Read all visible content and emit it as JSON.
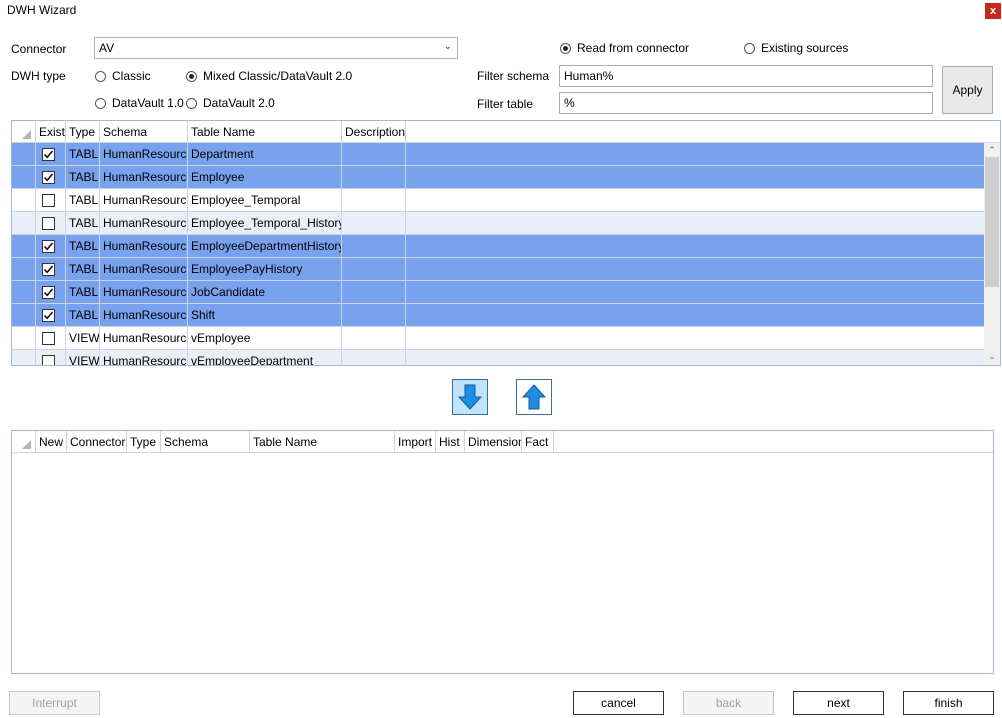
{
  "window": {
    "title": "DWH Wizard",
    "close_glyph": "x"
  },
  "connector": {
    "label": "Connector",
    "value": "AV"
  },
  "dwh_type": {
    "label": "DWH type",
    "options": [
      "Classic",
      "Mixed Classic/DataVault 2.0",
      "DataVault 1.0",
      "DataVault 2.0"
    ],
    "selected": "Mixed Classic/DataVault 2.0"
  },
  "source": {
    "options": [
      "Read from connector",
      "Existing sources"
    ],
    "selected": "Read from connector"
  },
  "filters": {
    "schema_label": "Filter schema",
    "schema_value": "Human%",
    "table_label": "Filter table",
    "table_value": "%",
    "apply_label": "Apply"
  },
  "source_grid": {
    "columns": [
      "Exist",
      "Type",
      "Schema",
      "Table Name",
      "Description"
    ],
    "rows": [
      {
        "exist": true,
        "type": "TABLE",
        "schema": "HumanResources",
        "table": "Department",
        "description": ""
      },
      {
        "exist": true,
        "type": "TABLE",
        "schema": "HumanResources",
        "table": "Employee",
        "description": ""
      },
      {
        "exist": false,
        "type": "TABLE",
        "schema": "HumanResources",
        "table": "Employee_Temporal",
        "description": ""
      },
      {
        "exist": false,
        "type": "TABLE",
        "schema": "HumanResources",
        "table": "Employee_Temporal_History",
        "description": ""
      },
      {
        "exist": true,
        "type": "TABLE",
        "schema": "HumanResources",
        "table": "EmployeeDepartmentHistory",
        "description": ""
      },
      {
        "exist": true,
        "type": "TABLE",
        "schema": "HumanResources",
        "table": "EmployeePayHistory",
        "description": ""
      },
      {
        "exist": true,
        "type": "TABLE",
        "schema": "HumanResources",
        "table": "JobCandidate",
        "description": ""
      },
      {
        "exist": true,
        "type": "TABLE",
        "schema": "HumanResources",
        "table": "Shift",
        "description": ""
      },
      {
        "exist": false,
        "type": "VIEW",
        "schema": "HumanResources",
        "table": "vEmployee",
        "description": ""
      },
      {
        "exist": false,
        "type": "VIEW",
        "schema": "HumanResources",
        "table": "vEmployeeDepartment",
        "description": ""
      }
    ]
  },
  "move_buttons": {
    "down_icon": "arrow-down-icon",
    "up_icon": "arrow-up-icon"
  },
  "target_grid": {
    "columns": [
      "New",
      "Connector",
      "Type",
      "Schema",
      "Table Name",
      "Import",
      "Hist",
      "Dimension",
      "Fact"
    ],
    "rows": []
  },
  "footer": {
    "interrupt": "Interrupt",
    "cancel": "cancel",
    "back": "back",
    "next": "next",
    "finish": "finish"
  },
  "colors": {
    "selected_row": "#79a2ee",
    "alt_row": "#eaeef6",
    "arrow_fill": "#1e8fe0",
    "arrow_button_bg": "#bfe3fb",
    "close_bg": "#c42b1c"
  }
}
